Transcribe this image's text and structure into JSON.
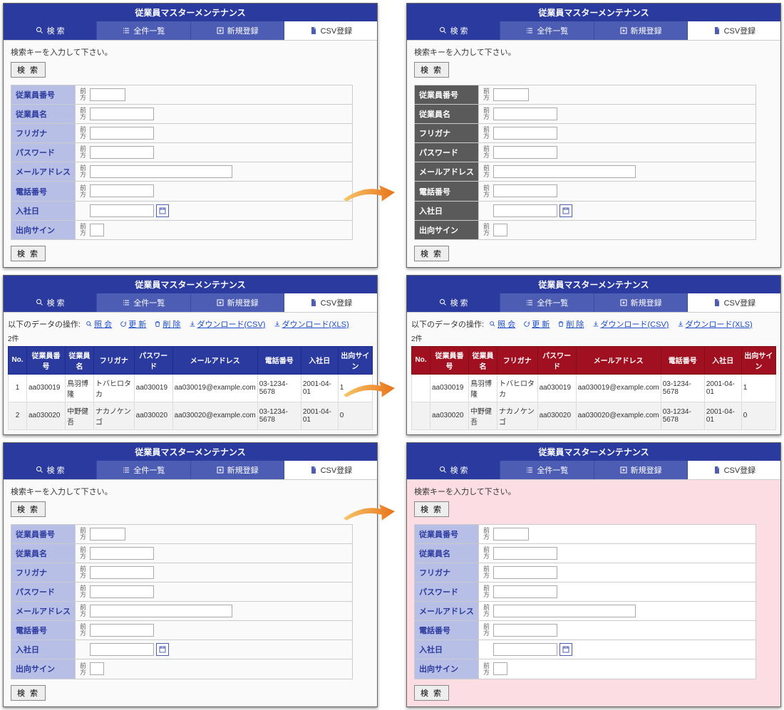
{
  "title": "従業員マスターメンテナンス",
  "tabs": {
    "search": "検 索",
    "list": "全件一覧",
    "new": "新規登録",
    "csv": "CSV登録"
  },
  "hint": "検索キーを入力して下さい。",
  "searchBtn": "検 索",
  "prefix": "前方",
  "fields": {
    "empNo": "従業員番号",
    "empName": "従業員名",
    "furigana": "フリガナ",
    "password": "パスワード",
    "email": "メールアドレス",
    "tel": "電話番号",
    "joinDate": "入社日",
    "sign": "出向サイン"
  },
  "ops": {
    "label": "以下のデータの操作:",
    "view": "照 会",
    "update": "更 新",
    "delete": "削 除",
    "dlcsv": "ダウンロード(CSV)",
    "dlxls": "ダウンロード(XLS)"
  },
  "count": "2件",
  "cols": [
    "No.",
    "従業員番号",
    "従業員名",
    "フリガナ",
    "パスワード",
    "メールアドレス",
    "電話番号",
    "入社日",
    "出向サイン"
  ],
  "rows": [
    [
      "1",
      "aa030019",
      "鳥羽博隆",
      "トバヒロタカ",
      "aa030019",
      "aa030019@example.com",
      "03-1234-5678",
      "2001-04-01",
      "1"
    ],
    [
      "2",
      "aa030020",
      "中野健吾",
      "ナカノケンゴ",
      "aa030020",
      "aa030020@example.com",
      "03-1234-5678",
      "2001-04-01",
      "0"
    ]
  ]
}
